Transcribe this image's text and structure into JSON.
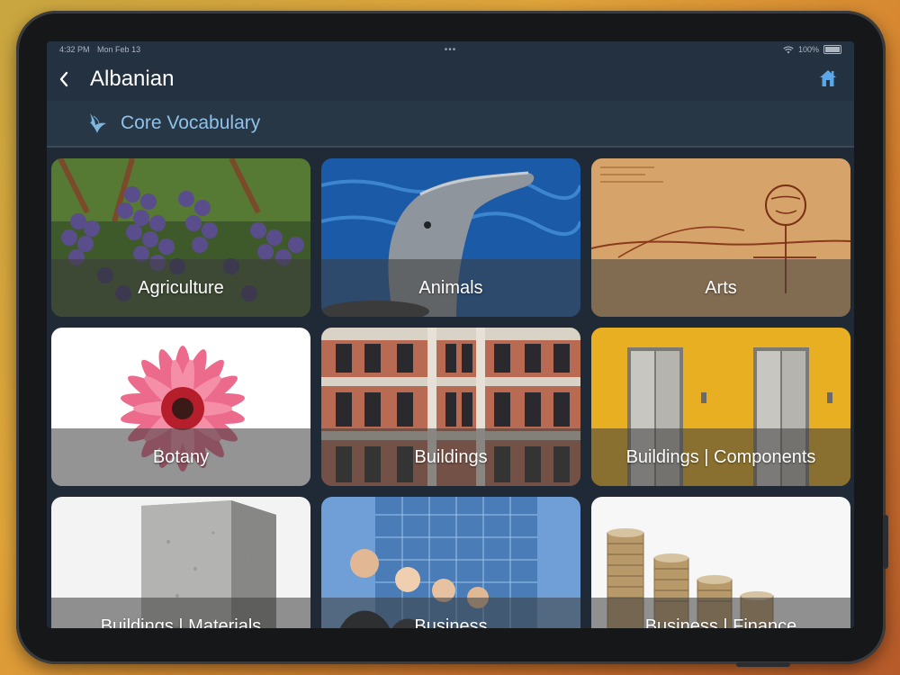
{
  "status_bar": {
    "time": "4:32 PM",
    "date": "Mon Feb 13",
    "battery": "100%"
  },
  "nav": {
    "title": "Albanian",
    "back_icon": "chevron-left-icon",
    "home_icon": "home-icon"
  },
  "subheader": {
    "title": "Core Vocabulary",
    "icon": "bird-icon"
  },
  "categories": [
    {
      "label": "Agriculture"
    },
    {
      "label": "Animals"
    },
    {
      "label": "Arts"
    },
    {
      "label": "Botany"
    },
    {
      "label": "Buildings"
    },
    {
      "label": "Buildings | Components"
    },
    {
      "label": "Buildings | Materials"
    },
    {
      "label": "Business"
    },
    {
      "label": "Business | Finance"
    }
  ],
  "colors": {
    "nav_bg": "#243140",
    "subheader_bg": "#283746",
    "accent": "#8fc2ea",
    "home_icon": "#5aa6e6"
  }
}
